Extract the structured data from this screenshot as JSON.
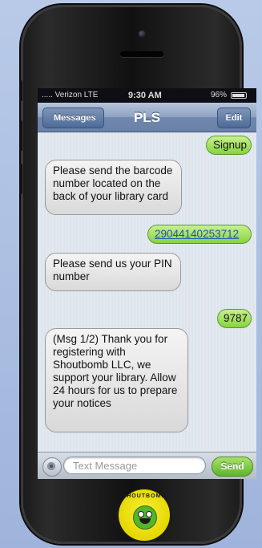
{
  "status_bar": {
    "carrier": "..... Verizon  LTE",
    "time": "9:30 AM",
    "battery": "96%"
  },
  "nav_bar": {
    "back_label": "Messages",
    "title": "PLS",
    "edit_label": "Edit"
  },
  "messages": [
    {
      "direction": "out",
      "text": "Signup"
    },
    {
      "direction": "in",
      "text": "Please send the barcode number located on the back of your library card"
    },
    {
      "direction": "out",
      "text": "29044140253712"
    },
    {
      "direction": "in",
      "text": "Please send us your PIN number"
    },
    {
      "direction": "out",
      "text": "9787"
    },
    {
      "direction": "in",
      "text": "(Msg 1/2) Thank you for registering with Shoutbomb LLC, we support your library. Allow 24 hours for us to prepare your notices"
    }
  ],
  "composer": {
    "placeholder": "Text Message",
    "send_label": "Send"
  },
  "logo": {
    "text": "SHOUTBOMB"
  }
}
